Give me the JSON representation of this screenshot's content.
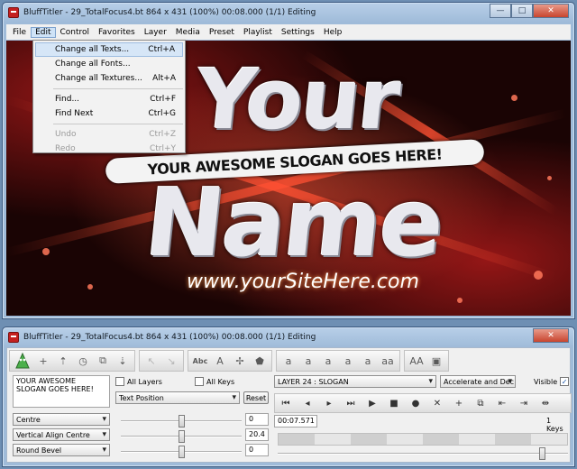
{
  "main_window": {
    "title": "BluffTitler - 29_TotalFocus4.bt 864 x 431 (100%) 00:08.000 (1/1) Editing",
    "buttons": {
      "minimize": "—",
      "maximize": "□",
      "close": "✕"
    }
  },
  "menubar": [
    "File",
    "Edit",
    "Control",
    "Favorites",
    "Layer",
    "Media",
    "Preset",
    "Playlist",
    "Settings",
    "Help"
  ],
  "edit_menu": {
    "items": [
      {
        "label": "Change all Texts...",
        "shortcut": "Ctrl+A"
      },
      {
        "label": "Change all Fonts...",
        "shortcut": ""
      },
      {
        "label": "Change all Textures...",
        "shortcut": "Alt+A"
      },
      {
        "label": "Find...",
        "shortcut": "Ctrl+F"
      },
      {
        "label": "Find Next",
        "shortcut": "Ctrl+G"
      },
      {
        "label": "Undo",
        "shortcut": "Ctrl+Z"
      },
      {
        "label": "Redo",
        "shortcut": "Ctrl+Y"
      }
    ]
  },
  "canvas": {
    "line1": "Your",
    "slogan": "YOUR AWESOME SLOGAN GOES HERE!",
    "line2": "Name",
    "website": "www.yourSiteHere.com"
  },
  "control_window": {
    "title": "BluffTitler - 29_TotalFocus4.bt 864 x 431 (100%) 00:08.000 (1/1) Editing",
    "text_field": "YOUR AWESOME SLOGAN GOES HERE!",
    "all_layers": "All Layers",
    "all_keys": "All Keys",
    "property_select": "Text Position",
    "reset": "Reset",
    "layer_select": "LAYER    24      : SLOGAN",
    "easing_select": "Accelerate and Dec",
    "visible": "Visible",
    "align_select": "Centre",
    "valign_select": "Vertical Align Centre",
    "bevel_select": "Round Bevel",
    "value1": "0",
    "value2": "20.4",
    "value3": "0",
    "time": "00:07.571",
    "keys": "1 Keys",
    "slider_levels": [
      0.5,
      0.5,
      0.5
    ],
    "timeline_position": 0.92
  }
}
